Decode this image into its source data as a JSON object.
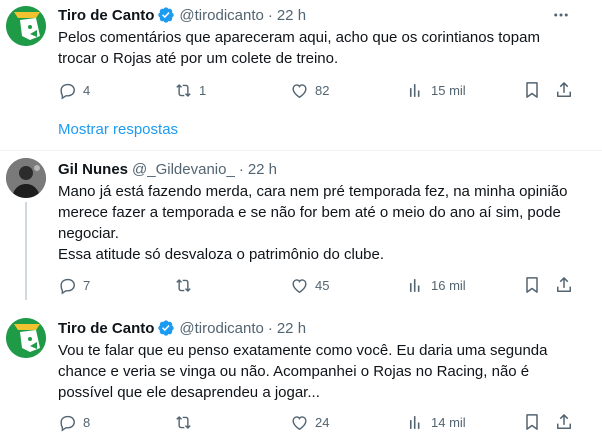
{
  "tweets": [
    {
      "name": "Tiro de Canto",
      "handle": "@tirodicanto",
      "time": "22 h",
      "text": [
        "Pelos comentários que apareceram aqui, acho que os corintianos topam trocar o Rojas até por um colete de treino."
      ],
      "replies": "4",
      "retweets": "1",
      "likes": "82",
      "views": "15 mil"
    },
    {
      "name": "Gil Nunes",
      "handle": "@_Gildevanio_",
      "time": "22 h",
      "text": [
        "Mano já está fazendo merda, cara nem pré temporada fez, na minha opinião merece fazer a temporada e se não for bem até o meio do ano aí sim, pode negociar.",
        "Essa atitude só desvaloza o patrimônio do clube."
      ],
      "replies": "7",
      "retweets": "",
      "likes": "45",
      "views": "16 mil"
    },
    {
      "name": "Tiro de Canto",
      "handle": "@tirodicanto",
      "time": "22 h",
      "text": [
        "Vou te falar que eu penso exatamente como você. Eu daria uma segunda chance e veria se vinga ou não. Acompanhei o Rojas no Racing, não é possível que ele desaprendeu a jogar..."
      ],
      "replies": "8",
      "retweets": "",
      "likes": "24",
      "views": "14 mil"
    }
  ],
  "show_replies_label": "Mostrar respostas",
  "separator": "·",
  "colors": {
    "accent": "#1d9bf0",
    "muted": "#536471",
    "text": "#0f1419",
    "brand_green": "#1f9a46",
    "verified": "#1d9bf0"
  },
  "icons": [
    "more-icon",
    "reply-icon",
    "retweet-icon",
    "like-icon",
    "views-icon",
    "bookmark-icon",
    "share-icon",
    "verified-badge-icon"
  ]
}
